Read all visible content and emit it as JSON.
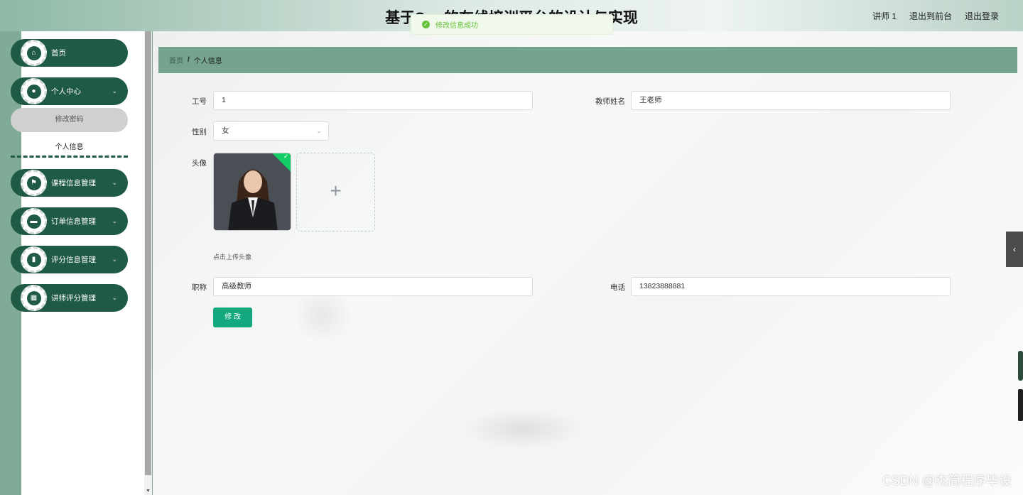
{
  "header": {
    "title": "基于Spr...的在线培训平台的设计与实现",
    "title_visible": "基于Spr        的在线培训平台的设计与实现",
    "links": [
      "讲师 1",
      "退出到前台",
      "退出登录"
    ]
  },
  "toast": {
    "message": "修改信息成功"
  },
  "sidebar": {
    "items": [
      {
        "label": "首页",
        "icon": "home-icon"
      },
      {
        "label": "个人中心",
        "icon": "user-icon"
      },
      {
        "label": "课程信息管理",
        "icon": "flag-icon"
      },
      {
        "label": "订单信息管理",
        "icon": "monitor-icon"
      },
      {
        "label": "评分信息管理",
        "icon": "bar-chart-icon"
      },
      {
        "label": "讲师评分管理",
        "icon": "grid-icon"
      }
    ],
    "sub_items": [
      "修改密码",
      "个人信息"
    ]
  },
  "breadcrumb": {
    "home": "首页",
    "separator": "/",
    "current": "个人信息"
  },
  "form": {
    "id_label": "工号",
    "id_value": "1",
    "name_label": "教师姓名",
    "name_value": "王老师",
    "gender_label": "性别",
    "gender_value": "女",
    "avatar_label": "头像",
    "upload_hint": "点击上传头像",
    "upload_plus": "+",
    "title_label": "职称",
    "title_value": "高级教师",
    "phone_label": "电话",
    "phone_value": "13823888881",
    "submit_label": "修 改"
  },
  "watermark": "CSDN @杰简程序毕设",
  "colors": {
    "sidebar_green": "#1f5a44",
    "breadcrumb_bar": "#76a38f",
    "submit": "#13a87d",
    "success": "#67c23a"
  }
}
